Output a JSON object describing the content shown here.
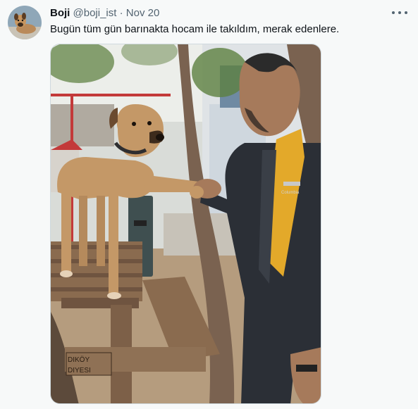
{
  "tweet": {
    "display_name": "Boji",
    "handle": "@boji_ist",
    "separator": "·",
    "timestamp": "Nov 20",
    "text": "Bugün tüm gün barınakta hocam ile takıldım, merak edenlere.",
    "avatar_icon": "dog-avatar",
    "more_icon": "more-horizontal-icon",
    "photo": {
      "bench_sign_line1": "DIKÖY",
      "bench_sign_line2": "DIYESI",
      "jacket_logo": "Columbia"
    }
  },
  "colors": {
    "background": "#f7f9f9",
    "primary_text": "#0f1419",
    "secondary_text": "#536471",
    "media_border": "#cfd9de"
  }
}
